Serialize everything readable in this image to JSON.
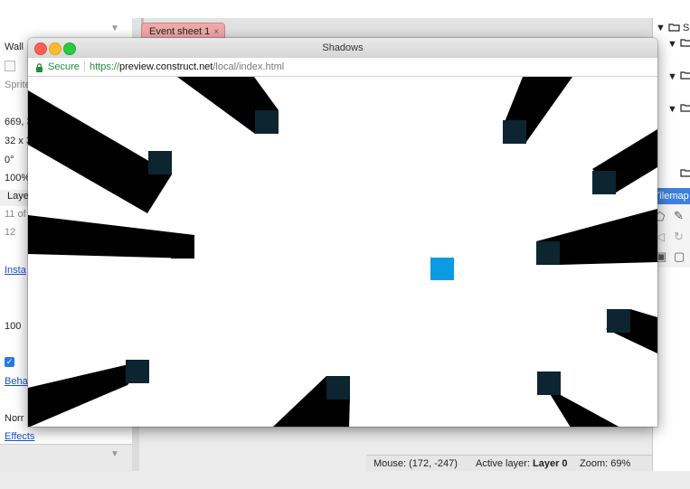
{
  "editor": {
    "tab_label": "Event sheet 1",
    "tab_close_glyph": "×",
    "scroll_arrow_glyph": "▼",
    "properties": {
      "object_name": "Wall",
      "plugin": "Sprite",
      "position": "669, 3",
      "size": "32 x 3",
      "angle": "0°",
      "opacity": "100%",
      "layer_label": "Laye",
      "uid": "11 of",
      "instance_count": "12",
      "instance_link": "Insta",
      "value": "100",
      "behaviors_link": "Beha",
      "blend": "Norr",
      "effects_link": "Effects"
    },
    "project_tree": [
      {
        "glyph": "▼",
        "label": "S"
      },
      {
        "glyph": "▼",
        "label": ""
      },
      {
        "glyph": "▼",
        "label": ""
      },
      {
        "glyph": "▼",
        "label": ""
      },
      {
        "glyph": "",
        "label": ""
      }
    ],
    "tilemap_label": "Tilemap",
    "status": {
      "mouse": "Mouse: (172, -247)",
      "active_layer_label": "Active layer:",
      "active_layer_value": "Layer 0",
      "zoom": "Zoom: 69%"
    }
  },
  "preview_window": {
    "title": "Shadows",
    "secure_label": "Secure",
    "url_protocol": "https://",
    "url_host": "preview.construct.net",
    "url_path": "/local/index.html"
  },
  "colors": {
    "light_block": "#0a9be3",
    "wall_block": "#0c2530",
    "shadow": "#000000",
    "tab_pink": "#f1a8a8",
    "tilemap_blue": "#3f7fe0"
  },
  "icons": [
    "lock-icon",
    "folder-icon",
    "pencil-icon",
    "undo-icon",
    "save-icon",
    "close-icon"
  ],
  "scene": {
    "light_count": 1,
    "wall_count": 12
  }
}
